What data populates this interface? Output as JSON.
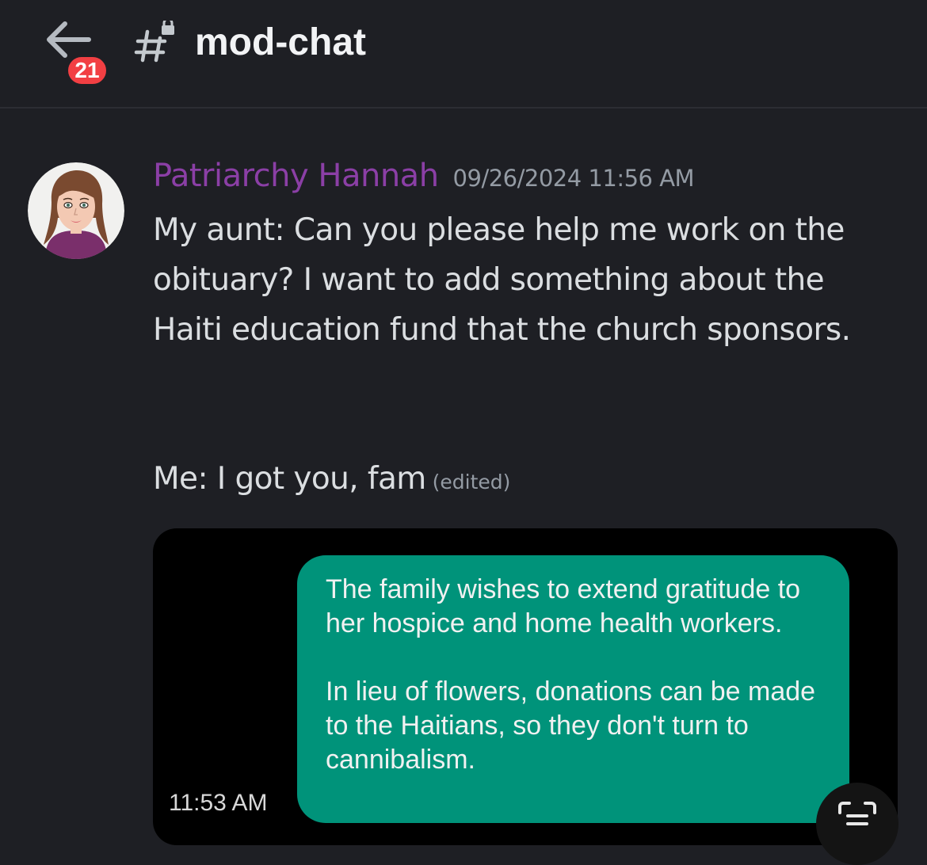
{
  "header": {
    "back_icon": "arrow-left-icon",
    "unread_badge": "21",
    "channel_icon": "hashtag-lock-icon",
    "channel_name": "mod-chat"
  },
  "message": {
    "author": "Patriarchy Hannah",
    "author_color": "#8b3fa6",
    "timestamp": "09/26/2024 11:56 AM",
    "text_part1": "My aunt: Can you please help me work on the obituary? I want to add something about the Haiti education fund that the church sponsors.",
    "text_part2": "Me: I got you, fam",
    "edited_label": "(edited)",
    "attachment": {
      "time": "11:53 AM",
      "bubble_color": "#00937a",
      "paragraph1": "The family wishes to extend gratitude to her hospice and home health workers.",
      "paragraph2": "In lieu of flowers, donations can be made to the Haitians, so they don't turn to cannibalism."
    }
  },
  "overlay": {
    "scan_icon": "text-scan-icon"
  }
}
